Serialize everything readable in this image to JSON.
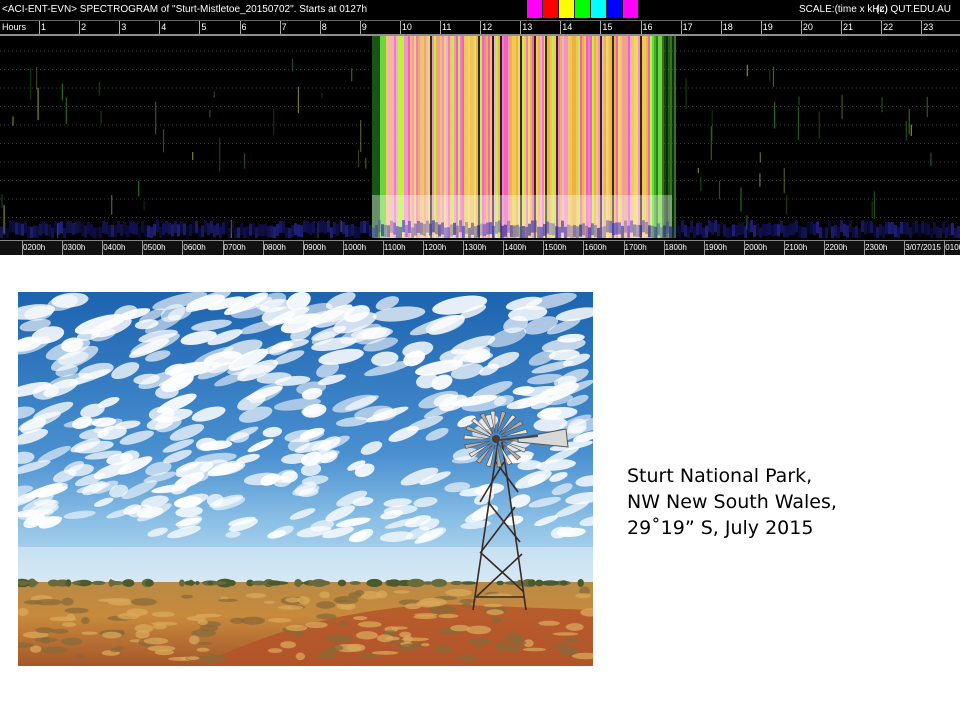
{
  "spectrogram": {
    "title": "<ACI-ENT-EVN> SPECTROGRAM  of \"Sturt-Mistletoe_20150702\".    Starts at 0127h",
    "scale": "SCALE:(time x kHz)",
    "copyright": "(c) QUT.EDU.AU",
    "swatch_colors": [
      "#ff00ff",
      "#ff0000",
      "#ffff00",
      "#00ff00",
      "#00ffff",
      "#0000ff",
      "#ff00ff"
    ],
    "hours_label": "Hours",
    "hour_ticks": [
      "1",
      "2",
      "3",
      "4",
      "5",
      "6",
      "7",
      "8",
      "9",
      "10",
      "11",
      "12",
      "13",
      "14",
      "15",
      "16",
      "17",
      "18",
      "19",
      "20",
      "21",
      "22",
      "23"
    ],
    "time_labels": [
      "0200h",
      "0300h",
      "0400h",
      "0500h",
      "0600h",
      "0700h",
      "0800h",
      "0900h",
      "1000h",
      "1100h",
      "1200h",
      "1300h",
      "1400h",
      "1500h",
      "1600h",
      "1700h",
      "1800h",
      "1900h",
      "2000h",
      "2100h",
      "2200h",
      "2300h",
      "3/07/2015",
      "0100"
    ]
  },
  "caption": {
    "line1": "Sturt National Park,",
    "line2": "NW New South Wales,",
    "line3": "29˚19” S, July 2015"
  }
}
